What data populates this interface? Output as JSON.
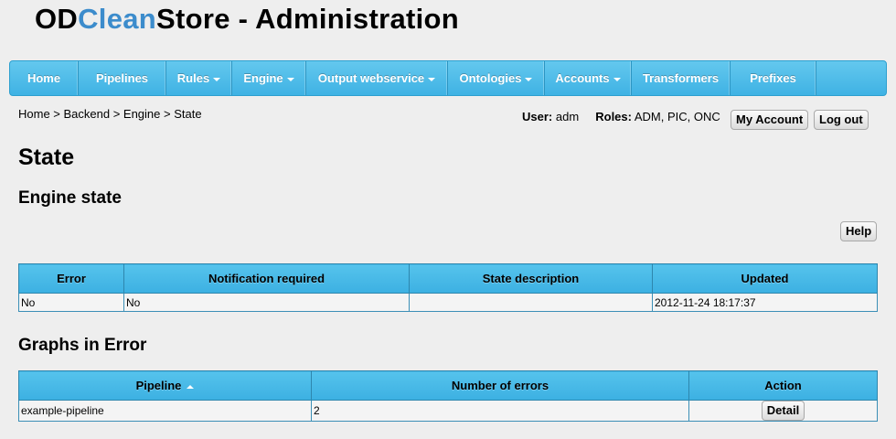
{
  "app": {
    "title_part1": "OD",
    "title_part2": "Clean",
    "title_part3": "Store - Administration"
  },
  "nav": [
    {
      "label": "Home",
      "dropdown": false
    },
    {
      "label": "Pipelines",
      "dropdown": false
    },
    {
      "label": "Rules",
      "dropdown": true
    },
    {
      "label": "Engine",
      "dropdown": true
    },
    {
      "label": "Output webservice",
      "dropdown": true
    },
    {
      "label": "Ontologies",
      "dropdown": true
    },
    {
      "label": "Accounts",
      "dropdown": true
    },
    {
      "label": "Transformers",
      "dropdown": false
    },
    {
      "label": "Prefixes",
      "dropdown": false
    }
  ],
  "breadcrumb": "Home > Backend > Engine > State",
  "user": {
    "user_label": "User:",
    "user_value": "adm",
    "roles_label": "Roles:",
    "roles_value": "ADM, PIC, ONC",
    "my_account": "My Account",
    "logout": "Log out"
  },
  "page_title": "State",
  "engine_section": {
    "title": "Engine state",
    "help": "Help",
    "columns": [
      "Error",
      "Notification required",
      "State description",
      "Updated"
    ],
    "row": {
      "error": "No",
      "notification": "No",
      "description": "",
      "updated": "2012-11-24 18:17:37"
    }
  },
  "graphs_section": {
    "title": "Graphs in Error",
    "columns": [
      "Pipeline",
      "Number of errors",
      "Action"
    ],
    "row": {
      "pipeline": "example-pipeline",
      "errors": "2",
      "action": "Detail"
    }
  },
  "colors": {
    "accent": "#3c8ccc",
    "nav_bg": "#4dbce8",
    "header_bg": "#4db9e7"
  }
}
